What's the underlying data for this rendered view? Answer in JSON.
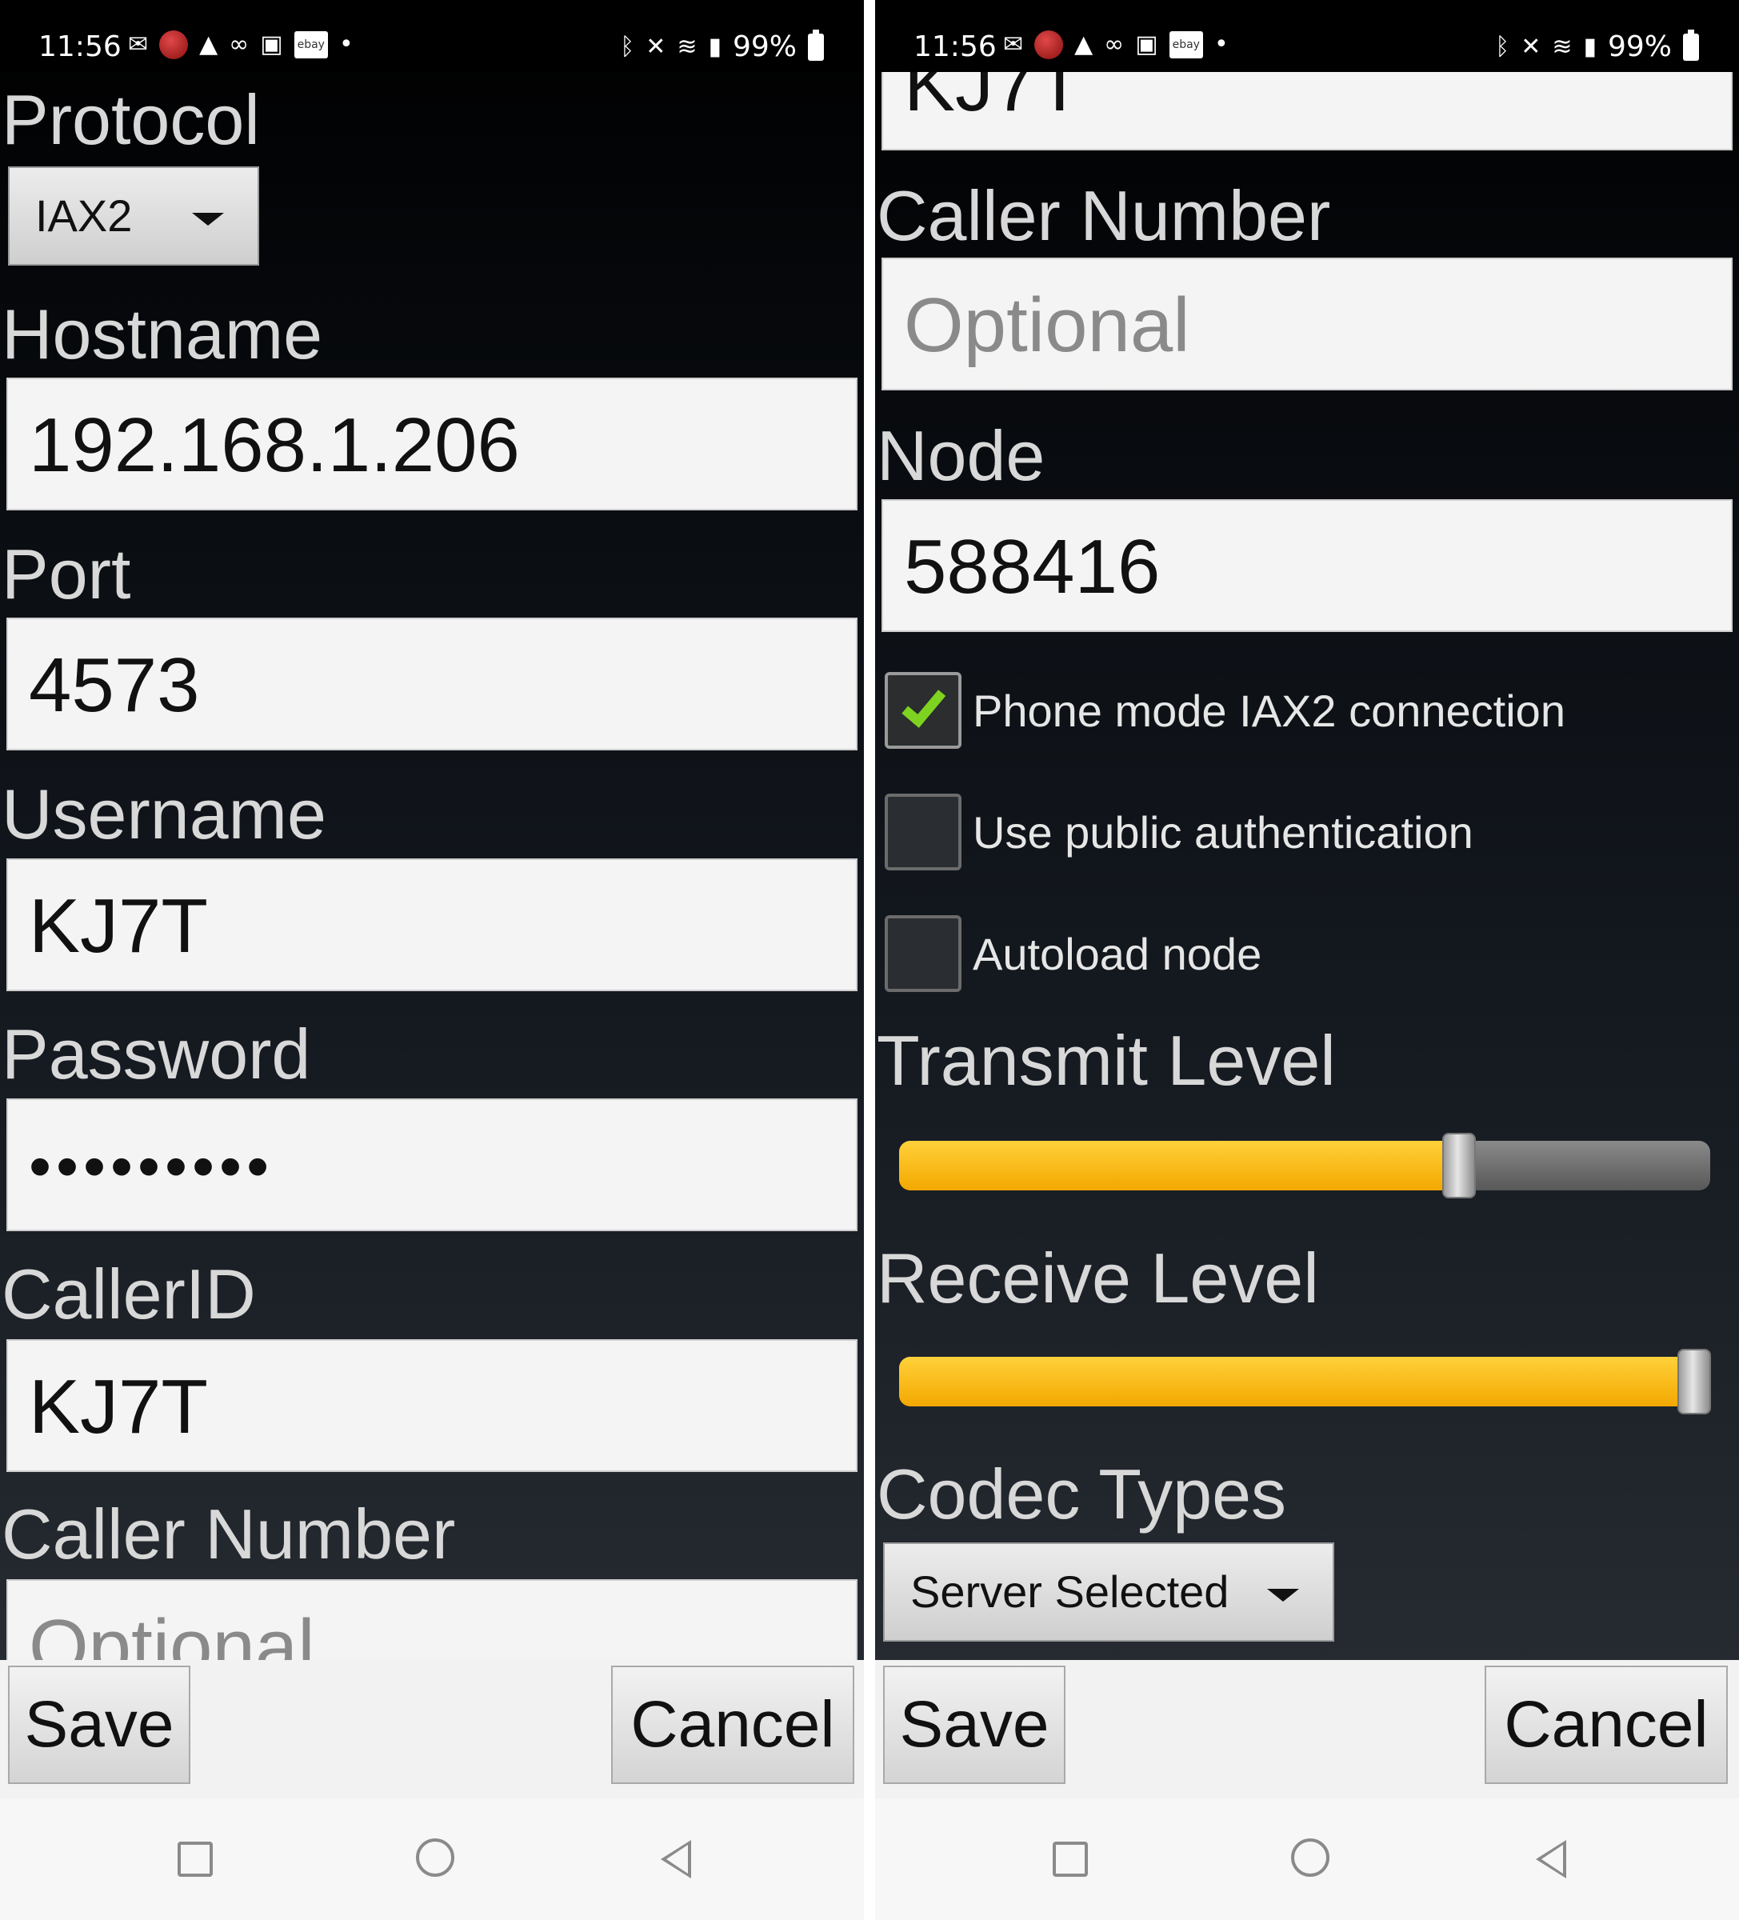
{
  "status_bar": {
    "time": "11:56",
    "battery": "99%",
    "icons_left": [
      "messenger-icon",
      "red-circle-icon",
      "warning-icon",
      "voicemail-icon",
      "outlook-icon",
      "ebay-icon",
      "dot-icon"
    ],
    "icons_right": [
      "bluetooth-icon",
      "mute-icon",
      "wifi-icon",
      "signal-icon",
      "battery-icon"
    ],
    "ebay_text": "ebay",
    "dot": "•"
  },
  "left": {
    "protocol_label": "Protocol",
    "protocol_value": "IAX2",
    "hostname_label": "Hostname",
    "hostname_value": "192.168.1.206",
    "port_label": "Port",
    "port_value": "4573",
    "username_label": "Username",
    "username_value": "KJ7T",
    "password_label": "Password",
    "password_value": "•••••••••",
    "callerid_label": "CallerID",
    "callerid_value": "KJ7T",
    "caller_number_label": "Caller Number",
    "caller_number_placeholder": "Optional"
  },
  "right": {
    "callerid_value_partial": "KJ7T",
    "caller_number_label": "Caller Number",
    "caller_number_placeholder": "Optional",
    "node_label": "Node",
    "node_value": "588416",
    "phone_mode_label": "Phone mode IAX2 connection",
    "phone_mode_checked": true,
    "public_auth_label": "Use public authentication",
    "public_auth_checked": false,
    "autoload_label": "Autoload node",
    "autoload_checked": false,
    "transmit_label": "Transmit Level",
    "transmit_level": 0.69,
    "receive_label": "Receive Level",
    "receive_level": 0.98,
    "codec_label": "Codec Types",
    "codec_value": "Server Selected"
  },
  "buttons": {
    "save": "Save",
    "cancel": "Cancel"
  },
  "colors": {
    "slider_fill": "#ffc000",
    "check_green": "#7ed321"
  }
}
